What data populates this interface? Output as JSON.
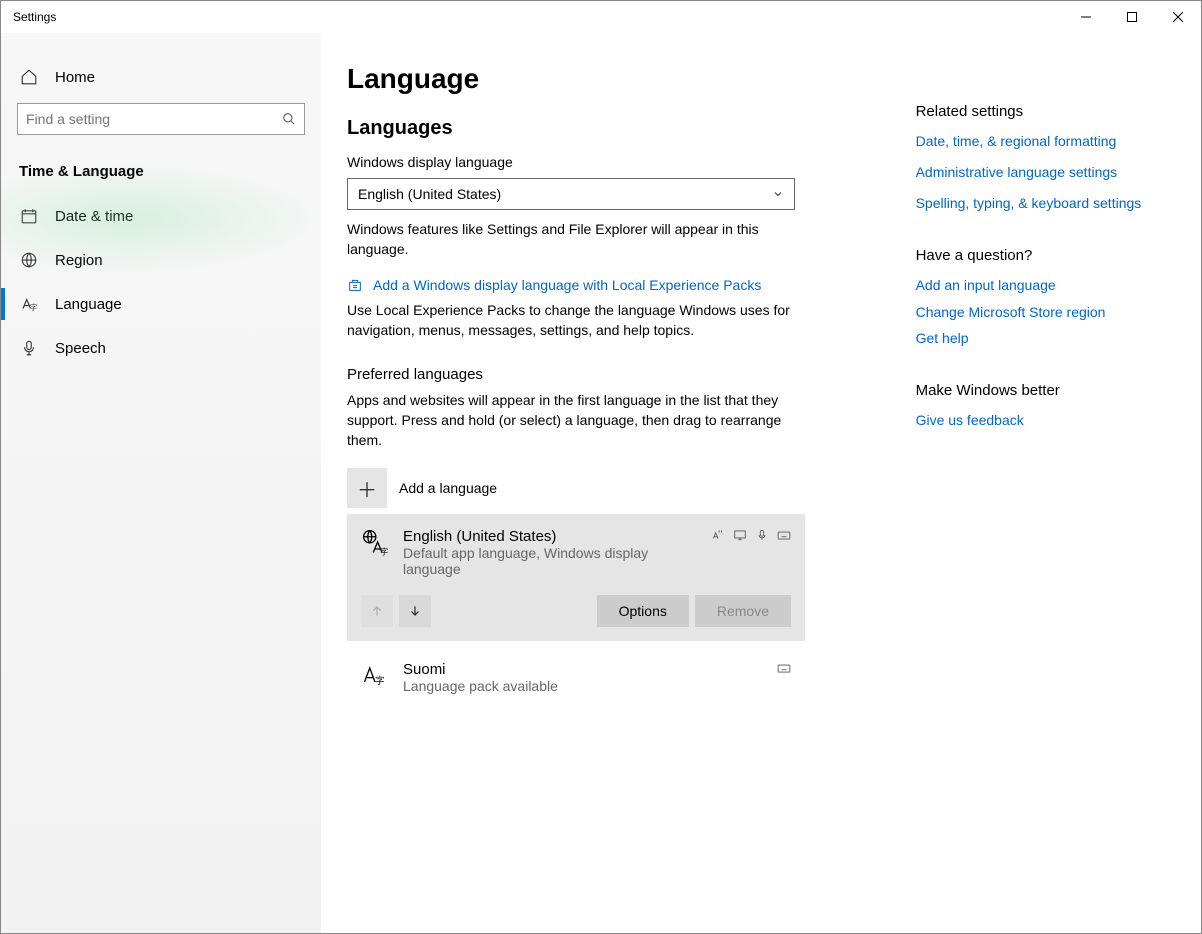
{
  "window": {
    "title": "Settings"
  },
  "sidebar": {
    "home": "Home",
    "search_placeholder": "Find a setting",
    "section": "Time & Language",
    "items": [
      {
        "label": "Date & time"
      },
      {
        "label": "Region"
      },
      {
        "label": "Language"
      },
      {
        "label": "Speech"
      }
    ]
  },
  "page": {
    "title": "Language",
    "languages_heading": "Languages",
    "display_lang_label": "Windows display language",
    "display_lang_value": "English (United States)",
    "display_lang_help": "Windows features like Settings and File Explorer will appear in this language.",
    "store_link": "Add a Windows display language with Local Experience Packs",
    "store_help": "Use Local Experience Packs to change the language Windows uses for navigation, menus, messages, settings, and help topics.",
    "preferred_heading": "Preferred languages",
    "preferred_help": "Apps and websites will appear in the first language in the list that they support. Press and hold (or select) a language, then drag to rearrange them.",
    "add_language": "Add a language",
    "lang_entries": [
      {
        "name": "English (United States)",
        "desc": "Default app language, Windows display language"
      },
      {
        "name": "Suomi",
        "desc": "Language pack available"
      }
    ],
    "btn_options": "Options",
    "btn_remove": "Remove"
  },
  "side": {
    "related_head": "Related settings",
    "related_1": "Date, time, & regional formatting",
    "related_2": "Administrative language settings",
    "related_3": "Spelling, typing, & keyboard settings",
    "question_head": "Have a question?",
    "question_1": "Add an input language",
    "question_2": "Change Microsoft Store region",
    "question_3": "Get help",
    "better_head": "Make Windows better",
    "better_1": "Give us feedback"
  }
}
